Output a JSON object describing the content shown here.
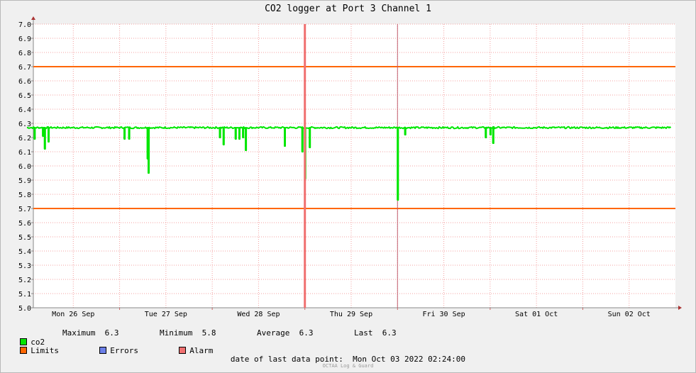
{
  "title": "CO2 logger at Port 3 Channel 1",
  "chart_data": {
    "type": "line",
    "title": "CO2 logger at Port 3 Channel 1",
    "ylim": [
      5.0,
      7.0
    ],
    "yticks": [
      "5.0",
      "5.1",
      "5.2",
      "5.3",
      "5.4",
      "5.5",
      "5.6",
      "5.7",
      "5.8",
      "5.9",
      "6.0",
      "6.1",
      "6.2",
      "6.3",
      "6.4",
      "6.5",
      "6.6",
      "6.7",
      "6.8",
      "6.9",
      "7.0"
    ],
    "xlim": [
      0,
      7.0
    ],
    "x_unit": "days since Mon 26 Sep 00:00",
    "xtick_labels": [
      "Mon 26 Sep",
      "Tue 27 Sep",
      "Wed 28 Sep",
      "Thu 29 Sep",
      "Fri 30 Sep",
      "Sat 01 Oct",
      "Sun 02 Oct"
    ],
    "grid": true,
    "limits": [
      5.7,
      6.7
    ],
    "alarm_x": [
      3.0
    ],
    "event_x": [
      4.0
    ],
    "series": [
      {
        "name": "co2",
        "color": "#00e600",
        "baseline": 6.27,
        "dips": [
          {
            "x": 0.08,
            "y": 6.19
          },
          {
            "x": 0.17,
            "y": 6.21
          },
          {
            "x": 0.19,
            "y": 6.12
          },
          {
            "x": 0.23,
            "y": 6.17
          },
          {
            "x": 1.05,
            "y": 6.19
          },
          {
            "x": 1.1,
            "y": 6.19
          },
          {
            "x": 1.3,
            "y": 6.05
          },
          {
            "x": 1.31,
            "y": 5.95
          },
          {
            "x": 2.08,
            "y": 6.2
          },
          {
            "x": 2.12,
            "y": 6.15
          },
          {
            "x": 2.25,
            "y": 6.19
          },
          {
            "x": 2.29,
            "y": 6.19
          },
          {
            "x": 2.33,
            "y": 6.2
          },
          {
            "x": 2.36,
            "y": 6.11
          },
          {
            "x": 2.78,
            "y": 6.14
          },
          {
            "x": 2.97,
            "y": 6.1
          },
          {
            "x": 3.0,
            "y": 5.91
          },
          {
            "x": 3.05,
            "y": 6.13
          },
          {
            "x": 4.0,
            "y": 5.76
          },
          {
            "x": 4.08,
            "y": 6.22
          },
          {
            "x": 4.95,
            "y": 6.2
          },
          {
            "x": 5.0,
            "y": 6.22
          },
          {
            "x": 5.03,
            "y": 6.16
          }
        ]
      }
    ]
  },
  "legend": {
    "co2_label": "co2",
    "max_label": "Maximum",
    "max_value": "6.3",
    "min_label": "Minimum",
    "min_value": "5.8",
    "avg_label": "Average",
    "avg_value": "6.3",
    "last_label": "Last",
    "last_value": "6.3",
    "limits_label": "Limits",
    "errors_label": "Errors",
    "alarm_label": "Alarm",
    "colors": {
      "co2": "#00e600",
      "limits": "#ff6600",
      "errors": "#6b7fe8",
      "alarm": "#f07070"
    }
  },
  "footer": "date of last data point:  Mon Oct 03 2022 02:24:00",
  "watermark": "OCTAA Log & Guard"
}
